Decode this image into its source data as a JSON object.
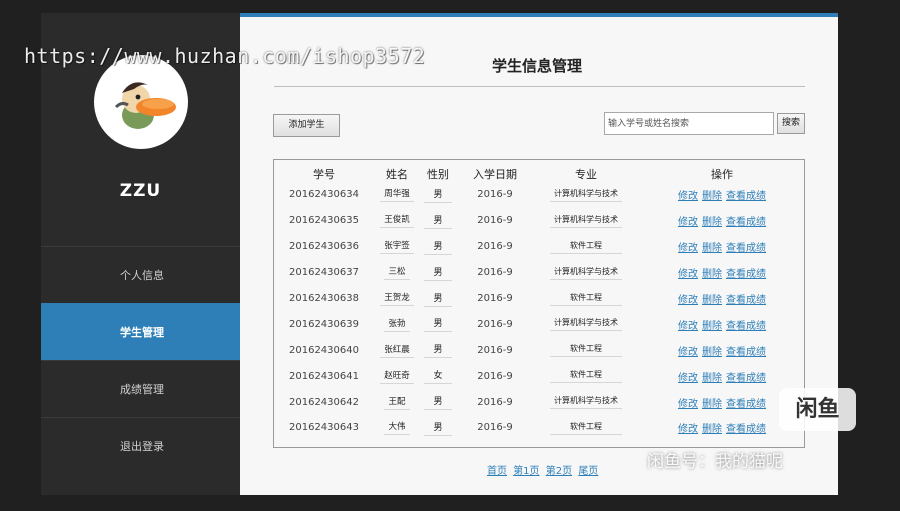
{
  "watermark": "https://www.huzhan.com/ishop3572",
  "sidebar": {
    "username": "ZZU",
    "items": [
      {
        "label": "个人信息"
      },
      {
        "label": "学生管理"
      },
      {
        "label": "成绩管理"
      },
      {
        "label": "退出登录"
      }
    ],
    "active_index": 1
  },
  "main": {
    "title": "学生信息管理",
    "add_button": "添加学生",
    "search": {
      "placeholder": "输入学号或姓名搜索",
      "value": "",
      "button": "搜索"
    },
    "table": {
      "headers": [
        "学号",
        "姓名",
        "性别",
        "入学日期",
        "专业",
        "操作"
      ],
      "rows": [
        {
          "id": "20162430634",
          "name": "周华强",
          "gender": "男",
          "date": "2016-9",
          "major": "计算机科学与技术"
        },
        {
          "id": "20162430635",
          "name": "王俊凯",
          "gender": "男",
          "date": "2016-9",
          "major": "计算机科学与技术"
        },
        {
          "id": "20162430636",
          "name": "张宇签",
          "gender": "男",
          "date": "2016-9",
          "major": "软件工程"
        },
        {
          "id": "20162430637",
          "name": "三松",
          "gender": "男",
          "date": "2016-9",
          "major": "计算机科学与技术"
        },
        {
          "id": "20162430638",
          "name": "王贺龙",
          "gender": "男",
          "date": "2016-9",
          "major": "软件工程"
        },
        {
          "id": "20162430639",
          "name": "张勃",
          "gender": "男",
          "date": "2016-9",
          "major": "计算机科学与技术"
        },
        {
          "id": "20162430640",
          "name": "张红晨",
          "gender": "男",
          "date": "2016-9",
          "major": "软件工程"
        },
        {
          "id": "20162430641",
          "name": "赵旺奇",
          "gender": "女",
          "date": "2016-9",
          "major": "软件工程"
        },
        {
          "id": "20162430642",
          "name": "王配",
          "gender": "男",
          "date": "2016-9",
          "major": "计算机科学与技术"
        },
        {
          "id": "20162430643",
          "name": "大伟",
          "gender": "男",
          "date": "2016-9",
          "major": "软件工程"
        }
      ],
      "actions": {
        "edit": "修改",
        "delete": "删除",
        "view_scores": "查看成绩"
      }
    },
    "pagination": {
      "first": "首页",
      "page1": "第1页",
      "page2": "第2页",
      "last": "尾页"
    }
  },
  "overlay": {
    "badge": "闲鱼",
    "caption": "闲鱼号：我的猫呢"
  }
}
